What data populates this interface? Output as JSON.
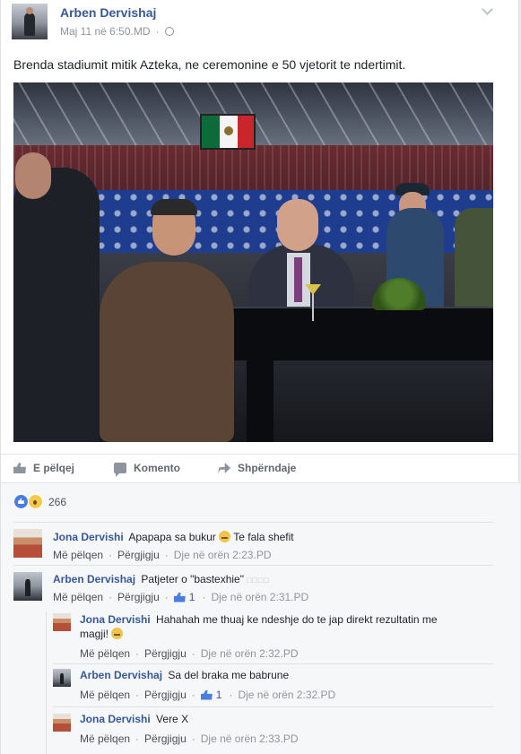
{
  "post": {
    "author": "Arben Dervishaj",
    "timestamp": "Maj 11 në 6:50.MD",
    "separator": "·",
    "text": "Brenda stadiumit mitik Azteka, ne ceremonine e 50 vjetorit te ndertimit."
  },
  "actions": {
    "like": "E pëlqej",
    "comment": "Komento",
    "share": "Shpërndaje"
  },
  "reactions": {
    "count": "266"
  },
  "comments": [
    {
      "author": "Jona Dervishi",
      "text_before": "Apapapa sa bukur",
      "text_after": "Te fala shefit",
      "like": "Më pëlqen",
      "reply": "Përgjigju",
      "time": "Dje në orën 2:23.PD"
    },
    {
      "author": "Arben Dervishaj",
      "text": "Patjeter o \"bastexhie\"",
      "boxes": "□□□□",
      "like": "Më pëlqen",
      "reply": "Përgjigju",
      "likes": "1",
      "time": "Dje në orën 2:31.PD"
    }
  ],
  "replies": [
    {
      "author": "Jona Dervishi",
      "line1": "Hahahah me thuaj ke ndeshje do te jap direkt rezultatin me",
      "line2": "magji!",
      "like": "Më pëlqen",
      "reply": "Përgjigju",
      "time": "Dje në orën 2:32.PD"
    },
    {
      "author": "Arben Dervishaj",
      "text": "Sa del braka me babrune",
      "like": "Më pëlqen",
      "reply": "Përgjigju",
      "likes": "1",
      "time": "Dje në orën 2:32.PD"
    },
    {
      "author": "Jona Dervishi",
      "text": "Vere X",
      "like": "Më pëlqen",
      "reply": "Përgjigju",
      "time": "Dje në orën 2:33.PD"
    }
  ],
  "colors": {
    "link_blue": "#365899",
    "meta_gray": "#90949c",
    "like_blue": "#4a7de2"
  }
}
